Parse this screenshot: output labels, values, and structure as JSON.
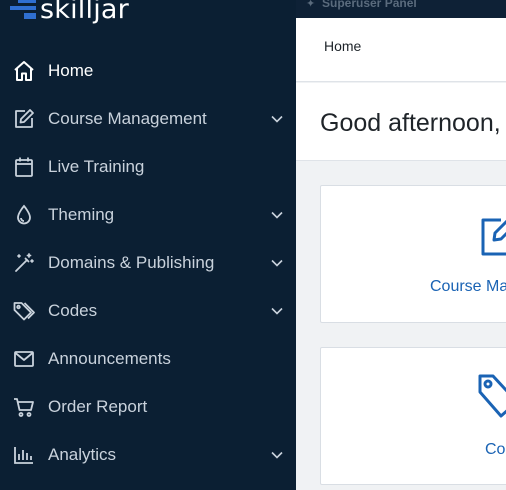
{
  "app": {
    "logo_text": "skilljar"
  },
  "topbar": {
    "superuser_label": "Superuser Panel"
  },
  "breadcrumb": {
    "home": "Home"
  },
  "greeting": "Good afternoon,",
  "sidebar": {
    "items": [
      {
        "label": "Home",
        "icon": "home-icon",
        "expandable": false,
        "active": true
      },
      {
        "label": "Course Management",
        "icon": "edit-icon",
        "expandable": true
      },
      {
        "label": "Live Training",
        "icon": "calendar-icon",
        "expandable": false
      },
      {
        "label": "Theming",
        "icon": "droplet-icon",
        "expandable": true
      },
      {
        "label": "Domains & Publishing",
        "icon": "magic-wand-icon",
        "expandable": true
      },
      {
        "label": "Codes",
        "icon": "tags-icon",
        "expandable": true
      },
      {
        "label": "Announcements",
        "icon": "mail-icon",
        "expandable": false
      },
      {
        "label": "Order Report",
        "icon": "cart-icon",
        "expandable": false
      },
      {
        "label": "Analytics",
        "icon": "bar-chart-icon",
        "expandable": true
      }
    ]
  },
  "cards": [
    {
      "label": "Course Ma",
      "icon": "edit-icon"
    },
    {
      "label": "Co",
      "icon": "tag-icon"
    }
  ],
  "colors": {
    "sidebar_bg": "#0b1f33",
    "accent": "#1a63b4",
    "logo_mark": "#2f6fd1"
  }
}
